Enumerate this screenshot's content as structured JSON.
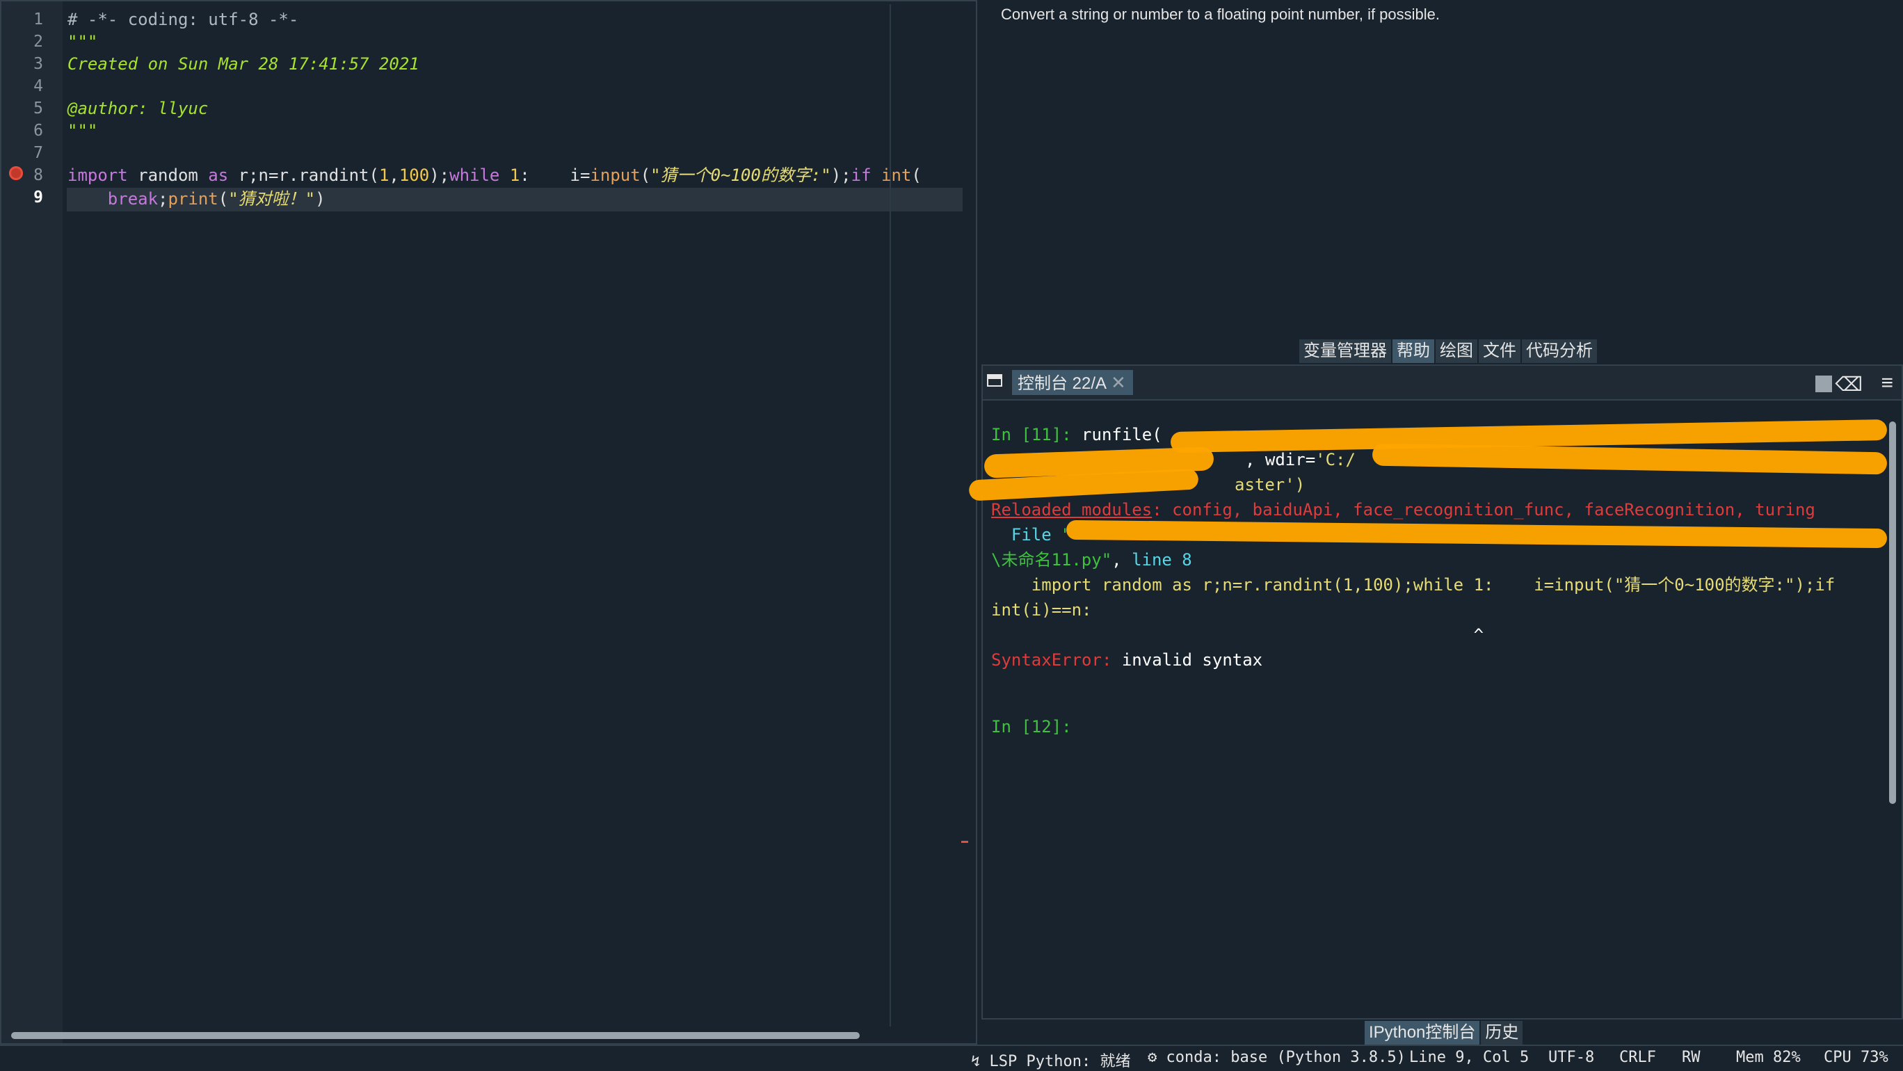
{
  "editor": {
    "line_numbers": [
      "1",
      "2",
      "3",
      "4",
      "5",
      "6",
      "7",
      "8",
      "9"
    ],
    "lines": {
      "l1": "# -*- coding: utf-8 -*-",
      "l2": "\"\"\"",
      "l3": "Created on Sun Mar 28 17:41:57 2021",
      "l5": "@author: llyuc",
      "l6": "\"\"\"",
      "l8": {
        "a": "import",
        "b": " random ",
        "c": "as",
        "d": " r;n=r.randint(",
        "e": "1",
        "f": ",",
        "g": "100",
        "h": ");",
        "i": "while",
        "j": " ",
        "k": "1",
        "l": ":    i=",
        "m": "input",
        "n": "(",
        "o": "\"猜一个0~100的数字:\"",
        "p": ");",
        "q": "if",
        "r": " ",
        "s": "int",
        "t": "("
      },
      "l9": {
        "a": "    ",
        "b": "break",
        "c": ";",
        "d": "print",
        "e": "(",
        "f": "\"猜对啦！\"",
        "g": ")"
      }
    }
  },
  "help": {
    "text": "Convert a string or number to a floating point number, if possible.",
    "tabs": [
      "变量管理器",
      "帮助",
      "绘图",
      "文件",
      "代码分析"
    ]
  },
  "console": {
    "tab_label": "控制台 22/A",
    "close_glyph": "✕",
    "lines": {
      "c1_prompt": "In [11]: ",
      "c1_text": "runfile(",
      "c2_text": ", wdir=",
      "c2_str": "'C:/",
      "c3_text": "aster')",
      "c4_red": "Reloaded modules",
      "c4_rest": ": config, baiduApi, face_recognition_func, faceRecognition, turing",
      "c5_file": "  File ",
      "c5_str": "\"",
      "c6_green": "\\未命名11.py\"",
      "c6_mid": ", ",
      "c6_cyan": "line 8",
      "c7": "    import random as r;n=r.randint(1,100);while 1:    i=input(\"猜一个0~100的数字:\");if",
      "c8": "int(i)==n:",
      "c9": "                                                ^",
      "c10_red": "SyntaxError:",
      "c10_rest": " invalid syntax",
      "c11_prompt": "In [12]:"
    },
    "bottom_tabs": [
      "IPython控制台",
      "历史"
    ]
  },
  "status": {
    "lsp": "LSP Python: 就绪",
    "conda": "conda: base (Python 3.8.5)",
    "pos": "Line 9, Col 5",
    "enc": "UTF-8",
    "eol": "CRLF",
    "rw": "RW",
    "mem": "Mem 82%",
    "cpu": "CPU 73%"
  }
}
